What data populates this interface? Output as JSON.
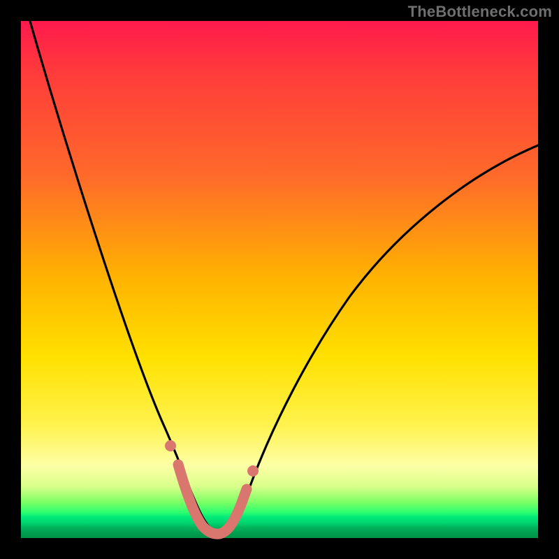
{
  "watermark": "TheBottleneck.com",
  "colors": {
    "background": "#000000",
    "curve": "#000000",
    "marker_fill": "#d9766e",
    "marker_stroke": "#d9766e",
    "marker_line": "#d9766e"
  },
  "chart_data": {
    "type": "line",
    "title": "",
    "xlabel": "",
    "ylabel": "",
    "xlim": [
      0,
      100
    ],
    "ylim": [
      0,
      100
    ],
    "gradient_background": {
      "top": "red",
      "middle": "yellow",
      "bottom": "green",
      "meaning": "bottleneck severity (high=red, optimal=green)"
    },
    "series": [
      {
        "name": "bottleneck-curve",
        "x": [
          0,
          2,
          5,
          8,
          12,
          16,
          20,
          24,
          27,
          29,
          31,
          33,
          35,
          37,
          39,
          41,
          45,
          50,
          55,
          60,
          66,
          74,
          82,
          90,
          100
        ],
        "y": [
          100,
          94,
          85,
          75,
          63,
          50,
          38,
          26,
          17,
          11,
          6,
          2,
          0.6,
          0.5,
          0.8,
          2,
          8,
          17,
          27,
          35,
          44,
          54,
          62,
          69,
          76
        ]
      }
    ],
    "markers": {
      "name": "highlighted-range",
      "description": "thick salmon segment near curve minimum",
      "x": [
        27.5,
        30,
        32,
        34,
        36,
        38,
        40,
        42.5
      ],
      "y": [
        15,
        7,
        2,
        0.6,
        0.5,
        1.2,
        3,
        10
      ],
      "dot_points_x": [
        27.5,
        42.5
      ],
      "dot_points_y": [
        15,
        10
      ]
    }
  }
}
